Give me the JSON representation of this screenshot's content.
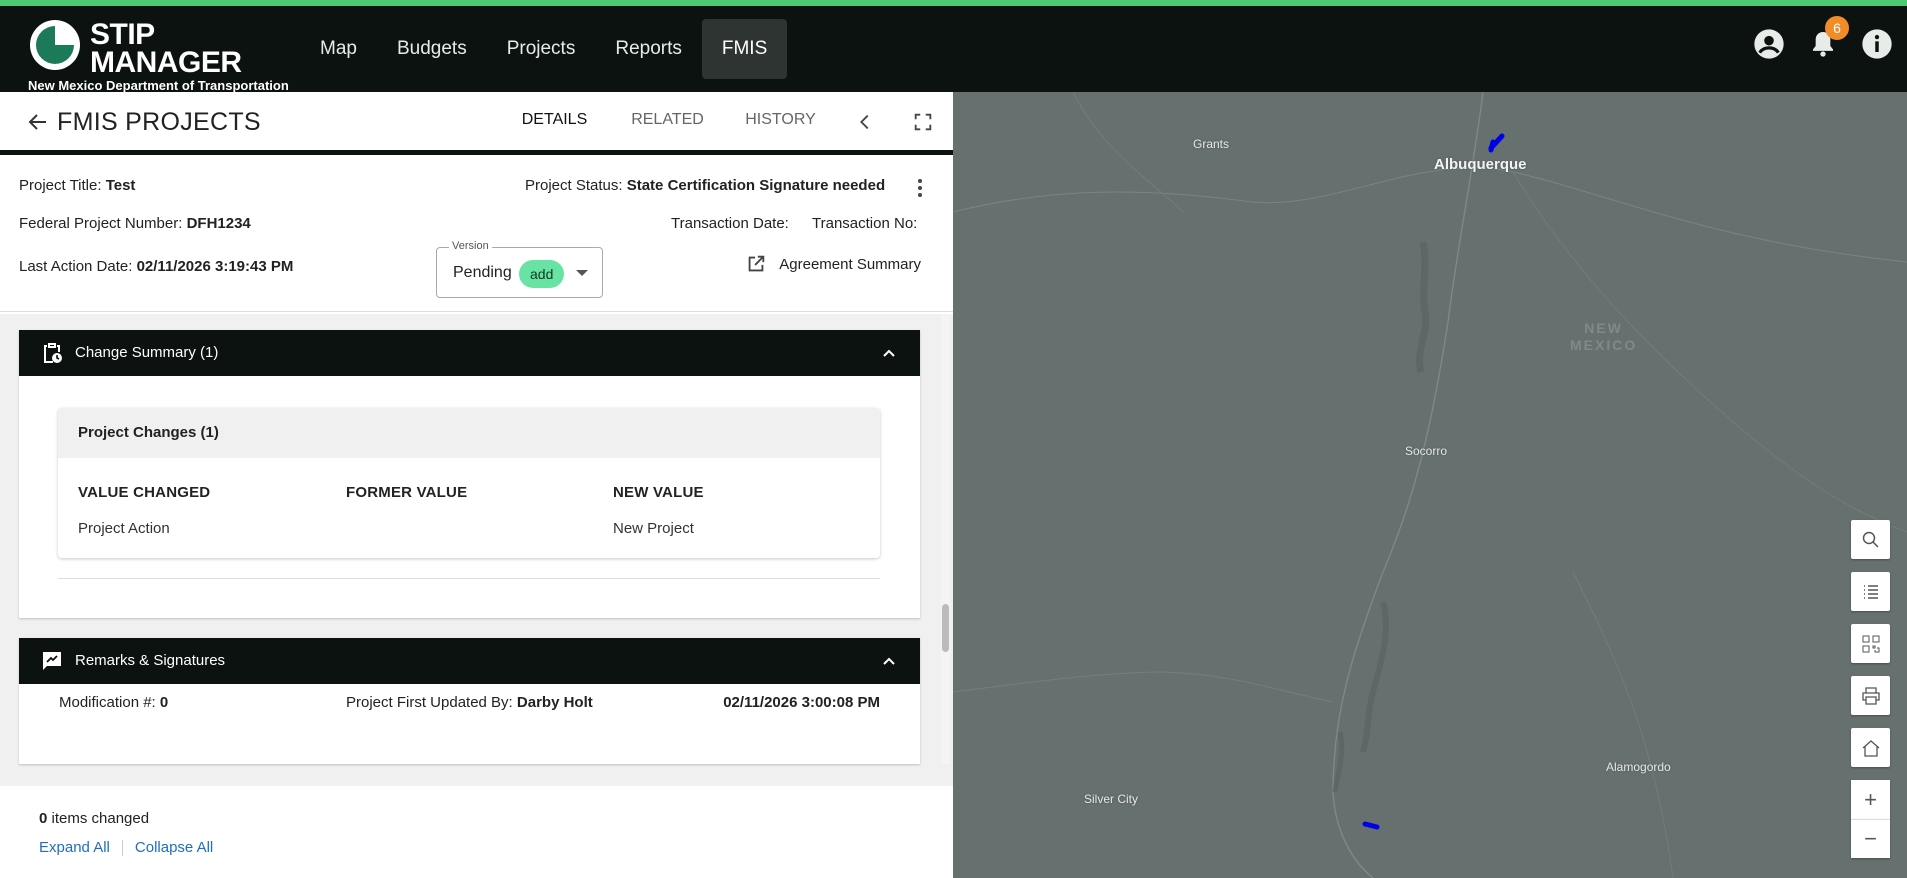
{
  "app": {
    "logo_line1": "STIP",
    "logo_line2": "MANAGER",
    "logo_sub": "New Mexico Department of Transportation",
    "nav": [
      "Map",
      "Budgets",
      "Projects",
      "Reports",
      "FMIS"
    ],
    "active_nav": "FMIS",
    "notification_count": "6",
    "colors": {
      "accent": "#4cc971",
      "topbar": "#0b1210",
      "chip": "#69e3a3",
      "link": "#1e6fbf"
    }
  },
  "panel": {
    "title": "FMIS PROJECTS",
    "tabs": [
      "DETAILS",
      "RELATED",
      "HISTORY"
    ],
    "active_tab": "DETAILS"
  },
  "details": {
    "project_title_label": "Project Title:",
    "project_title": "Test",
    "project_status_label": "Project Status:",
    "project_status": "State Certification Signature needed",
    "federal_number_label": "Federal Project Number:",
    "federal_number": "DFH1234",
    "transaction_date_label": "Transaction Date:",
    "transaction_no_label": "Transaction No:",
    "last_action_label": "Last Action Date:",
    "last_action": "02/11/2026 3:19:43 PM",
    "version_label": "Version",
    "version_value": "Pending",
    "version_chip": "add",
    "agreement_summary": "Agreement Summary"
  },
  "change_summary": {
    "title": "Change Summary (1)",
    "inner_title": "Project Changes (1)",
    "columns": [
      "VALUE CHANGED",
      "FORMER VALUE",
      "NEW VALUE"
    ],
    "rows": [
      {
        "value_changed": "Project Action",
        "former_value": "",
        "new_value": "New Project"
      }
    ]
  },
  "remarks": {
    "title": "Remarks & Signatures",
    "modification_label": "Modification #:",
    "modification": "0",
    "first_updated_label": "Project First Updated By:",
    "first_updated_by": "Darby Holt",
    "timestamp": "02/11/2026 3:00:08 PM"
  },
  "footer": {
    "count": "0",
    "count_suffix": "items changed",
    "expand_all": "Expand All",
    "collapse_all": "Collapse All"
  },
  "map": {
    "labels": {
      "grants": "Grants",
      "albuquerque": "Albuquerque",
      "state1": "NEW",
      "state2": "MEXICO",
      "socorro": "Socorro",
      "alamogordo": "Alamogordo",
      "silver_city": "Silver City"
    },
    "tools": [
      "search-icon",
      "list-icon",
      "qr-icon",
      "print-icon",
      "home-icon",
      "zoom-in-icon",
      "zoom-out-icon"
    ],
    "zoom_in": "+",
    "zoom_out": "−"
  }
}
